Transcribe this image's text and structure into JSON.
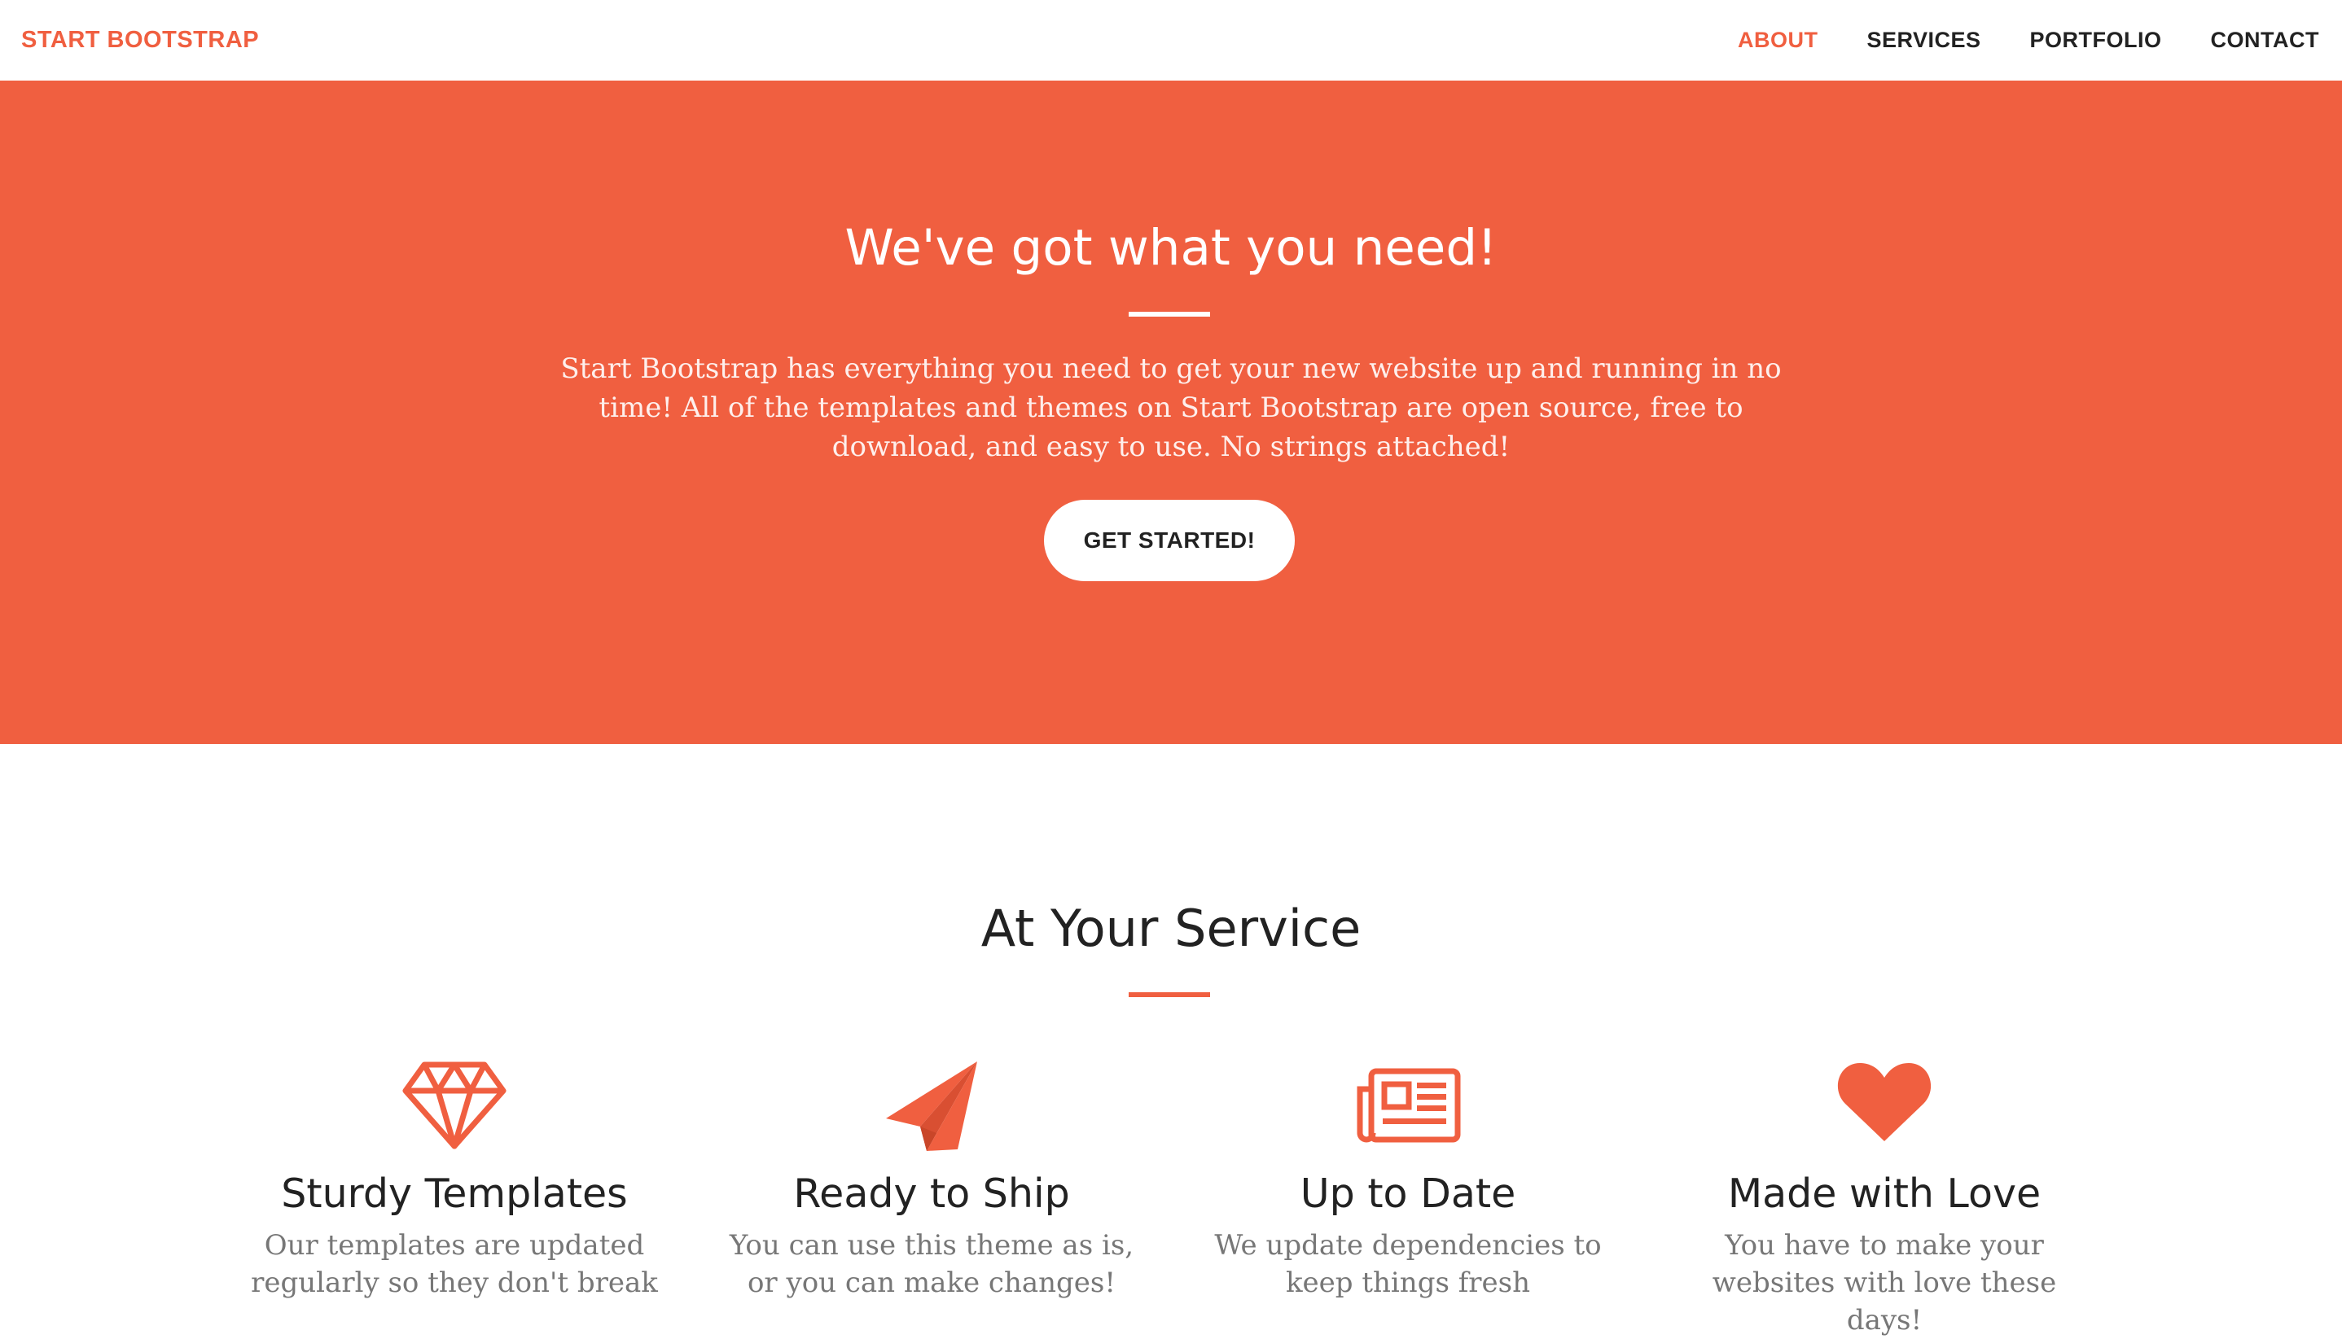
{
  "navbar": {
    "brand": "START BOOTSTRAP",
    "links": [
      "ABOUT",
      "SERVICES",
      "PORTFOLIO",
      "CONTACT"
    ],
    "active": "ABOUT"
  },
  "hero": {
    "title": "We've got what you need!",
    "text": "Start Bootstrap has everything you need to get your new website up and running in no time! All of the templates and themes on Start Bootstrap are open source, free to download, and easy to use. No strings attached!",
    "button": "GET STARTED!"
  },
  "services": {
    "title": "At Your Service",
    "items": [
      {
        "icon": "diamond-icon",
        "name": "Sturdy Templates",
        "desc": "Our templates are updated regularly so they don't break"
      },
      {
        "icon": "paper-plane-icon",
        "name": "Ready to Ship",
        "desc": "You can use this theme as is, or you can make changes!"
      },
      {
        "icon": "newspaper-icon",
        "name": "Up to Date",
        "desc": "We update dependencies to keep things fresh"
      },
      {
        "icon": "heart-icon",
        "name": "Made with Love",
        "desc": "You have to make your websites with love these days!"
      }
    ]
  },
  "colors": {
    "accent": "#f05f40",
    "text_dark": "#222222",
    "text_muted": "#777777"
  }
}
